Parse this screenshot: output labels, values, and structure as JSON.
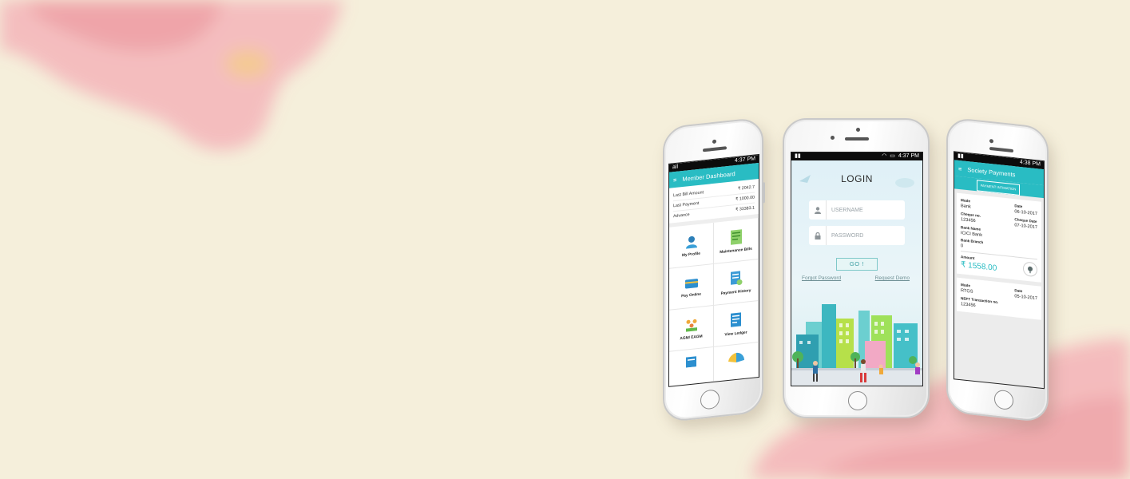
{
  "background": {
    "base": "#f5efdb",
    "wash": "#f1a4ab"
  },
  "phones": {
    "dashboard": {
      "status": {
        "left": "all",
        "time": "4:37 PM"
      },
      "appbar": {
        "menu_icon": "hamburger-icon",
        "title": "Member Dashboard"
      },
      "summary": [
        {
          "label": "Last Bill Amount",
          "value": "₹ 2042.7"
        },
        {
          "label": "Last Payment",
          "value": "₹ 1000.00"
        },
        {
          "label": "Advance",
          "value": "₹ 33383.1"
        }
      ],
      "tiles": [
        {
          "label": "My Profile",
          "icon": "profile-icon"
        },
        {
          "label": "Maintenance Bills",
          "icon": "bill-icon"
        },
        {
          "label": "Pay Online",
          "icon": "card-icon"
        },
        {
          "label": "Payment History",
          "icon": "history-icon"
        },
        {
          "label": "AGM/ EAGM",
          "icon": "meeting-icon"
        },
        {
          "label": "View Ledger",
          "icon": "ledger-icon"
        }
      ]
    },
    "login": {
      "status": {
        "time": "4:37 PM"
      },
      "title": "LOGIN",
      "username_placeholder": "USERNAME",
      "password_placeholder": "PASSWORD",
      "go_label": "GO !",
      "forgot_label": "Forgot Password",
      "demo_label": "Request Demo"
    },
    "payments": {
      "status": {
        "time": "4:38 PM"
      },
      "appbar": {
        "menu_icon": "hamburger-icon",
        "title": "Society Payments"
      },
      "tab_label": "PAYMENT INTIMATION",
      "entries": [
        {
          "mode_label": "Mode",
          "mode_value": "Bank",
          "date_label": "Date",
          "date_value": "06-10-2017",
          "cheque_label": "Cheque no.",
          "cheque_value": "123456",
          "cheque_date_label": "Cheque Date",
          "cheque_date_value": "07-10-2017",
          "bank_label": "Bank Name",
          "bank_value": "ICICI Bank",
          "branch_label": "Bank Branch",
          "branch_value": "0",
          "amount_label": "Amount",
          "amount_value": "₹ 1558.00"
        },
        {
          "mode_label": "Mode",
          "mode_value": "RTGS",
          "date_label": "Date",
          "date_value": "05-10-2017",
          "neft_label": "NEFT Transaction no.",
          "neft_value": "123456"
        }
      ]
    }
  }
}
